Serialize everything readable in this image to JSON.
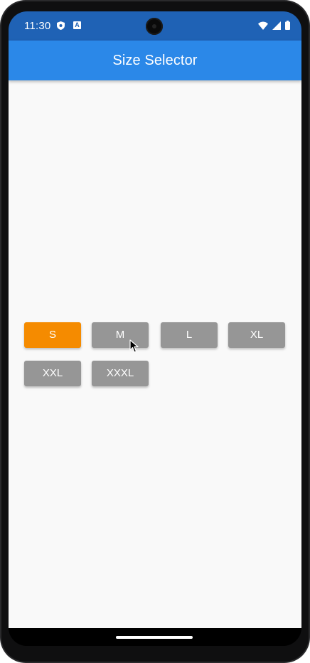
{
  "status_bar": {
    "time": "11:30",
    "left_icons": [
      "shield-icon",
      "a-icon"
    ],
    "right_icons": [
      "wifi-icon",
      "signal-icon",
      "battery-icon"
    ],
    "color": "#1f62b5"
  },
  "app_bar": {
    "title": "Size Selector",
    "color": "#2b88e8"
  },
  "sizes": {
    "selected": "S",
    "selected_color": "#f58b00",
    "unselected_color": "#969696",
    "items": [
      {
        "label": "S",
        "selected": true
      },
      {
        "label": "M",
        "selected": false
      },
      {
        "label": "L",
        "selected": false
      },
      {
        "label": "XL",
        "selected": false
      },
      {
        "label": "XXL",
        "selected": false
      },
      {
        "label": "XXXL",
        "selected": false
      }
    ]
  },
  "cursor": {
    "icon": "mouse-pointer-icon"
  }
}
